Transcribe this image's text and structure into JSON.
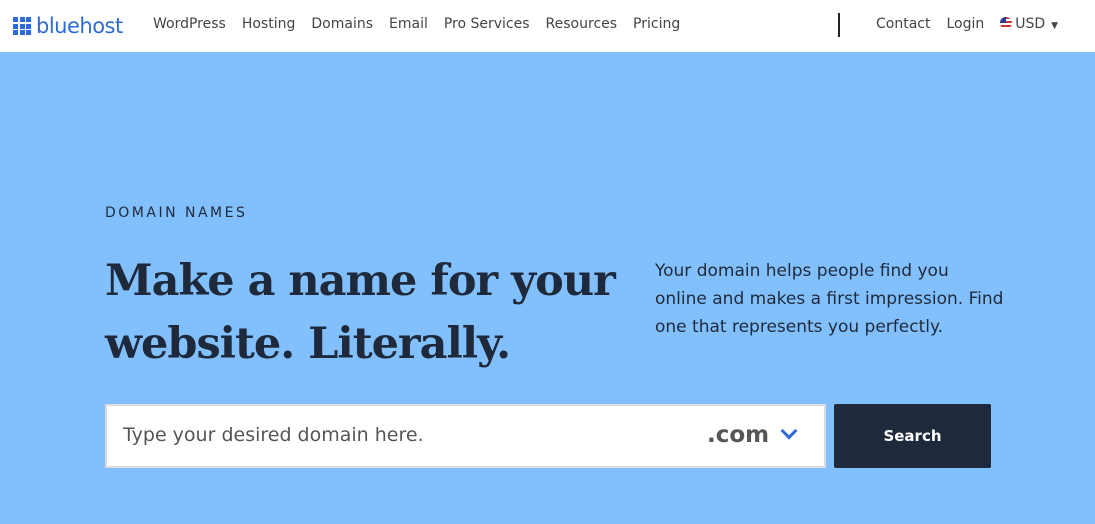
{
  "header": {
    "logo": "bluehost",
    "links": [
      "WordPress",
      "Hosting",
      "Domains",
      "Email",
      "Pro Services",
      "Resources",
      "Pricing"
    ],
    "contact": "Contact",
    "login": "Login",
    "currency": "USD"
  },
  "hero": {
    "eyebrow": "DOMAIN NAMES",
    "headline_line1": "Make a name for your",
    "headline_line2": "website. Literally.",
    "description": "Your domain helps people find you online and makes a first impression. Find one that represents you perfectly.",
    "search_placeholder": "Type your desired domain here.",
    "tld": ".com",
    "search_button": "Search"
  },
  "colors": {
    "brand": "#2e6bd8",
    "background": "#82bffd",
    "dark": "#1e2a3b"
  }
}
